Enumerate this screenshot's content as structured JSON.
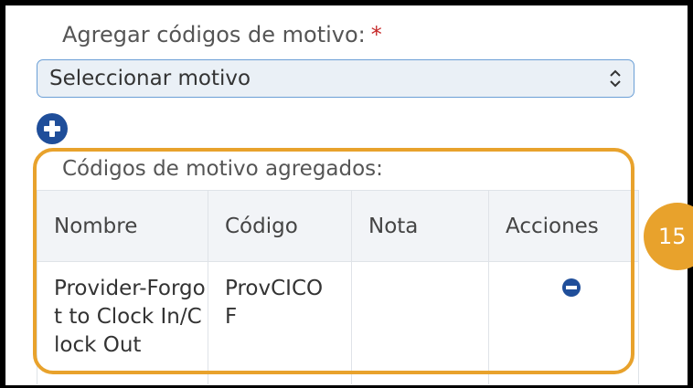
{
  "form": {
    "reason_label": "Agregar códigos de motivo:",
    "required_mark": "*",
    "select_placeholder": "Seleccionar motivo",
    "added_label": "Códigos de motivo agregados:"
  },
  "table": {
    "headers": [
      "Nombre",
      "Código",
      "Nota",
      "Acciones"
    ],
    "rows": [
      {
        "nombre": "Provider-Forgot to Clock In/Clock Out",
        "codigo": "ProvCICOF",
        "nota": ""
      }
    ]
  },
  "annotation": {
    "step_number": "15",
    "highlight_color": "#e8a22c"
  },
  "colors": {
    "accent": "#1f4e9a",
    "required": "#c62828"
  },
  "icons": [
    "chevron-up-down-icon",
    "plus-circle-icon",
    "minus-circle-icon"
  ]
}
